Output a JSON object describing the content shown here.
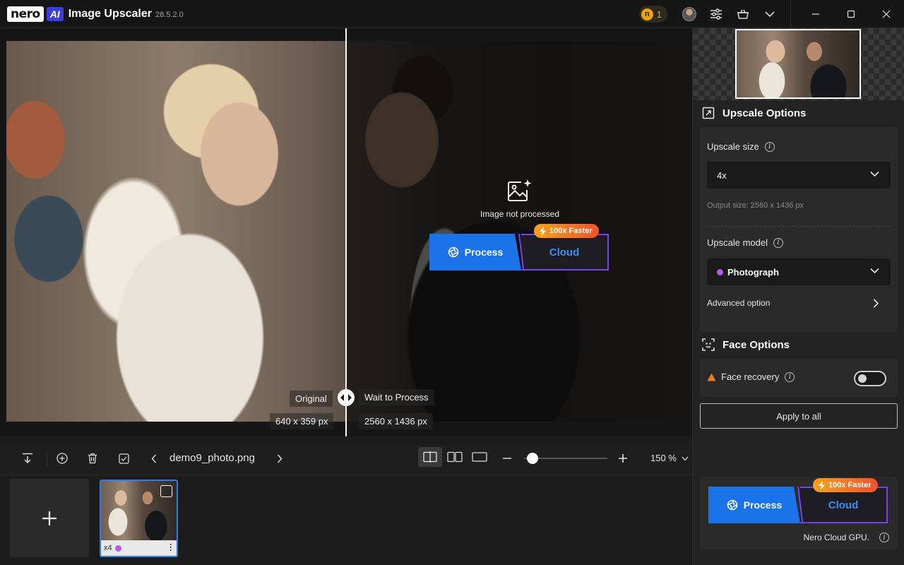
{
  "titlebar": {
    "logo_nero": "nero",
    "logo_ai": "AI",
    "app_name": "Image Upscaler",
    "version": "28.5.2.0",
    "credit_coin": "n",
    "credit_count": "1"
  },
  "canvas": {
    "original_label": "Original",
    "original_size": "640 x 359 px",
    "processed_label": "Wait to Process",
    "processed_size": "2560 x 1436 px",
    "not_processed_text": "Image not processed",
    "process_label": "Process",
    "cloud_label": "Cloud",
    "faster_badge": "100x Faster"
  },
  "right_panel": {
    "upscale_options_title": "Upscale Options",
    "upscale_size_label": "Upscale size",
    "upscale_size_value": "4x",
    "output_size": "Output size: 2560 x 1436 px",
    "upscale_model_label": "Upscale model",
    "upscale_model_value": "Photograph",
    "model_dot_color": "#b35be8",
    "advanced_option_label": "Advanced option",
    "face_options_title": "Face Options",
    "face_recovery_label": "Face recovery",
    "face_recovery_enabled": false,
    "apply_to_all_label": "Apply to all",
    "process_label": "Process",
    "cloud_label": "Cloud",
    "faster_badge": "100x Faster",
    "cloud_gpu_label": "Nero Cloud GPU."
  },
  "toolbar": {
    "filename": "demo9_photo.png",
    "zoom_value": "150 %",
    "zoom_fraction": 0.1
  },
  "filmstrip": {
    "items": [
      {
        "scale_label": "x4",
        "dot_color": "#b35be8",
        "selected": true
      }
    ]
  },
  "colors": {
    "accent_blue": "#1a73e8",
    "cloud_purple": "#7b3ff2",
    "badge_orange": "#f7a21a",
    "warning_orange": "#f07a2a"
  }
}
